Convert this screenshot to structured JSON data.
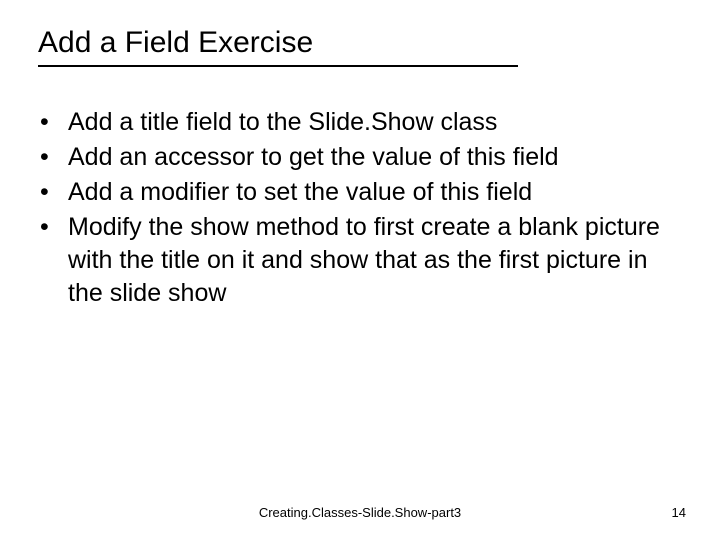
{
  "title": "Add a Field Exercise",
  "bullets": [
    "Add a title field to the Slide.Show class",
    "Add an accessor to get the value of this field",
    "Add a modifier to set the value of this field",
    "Modify the show method to first create a blank picture with the title on it and show that as the first picture in the slide show"
  ],
  "footer": {
    "center": "Creating.Classes-Slide.Show-part3",
    "page": "14"
  }
}
